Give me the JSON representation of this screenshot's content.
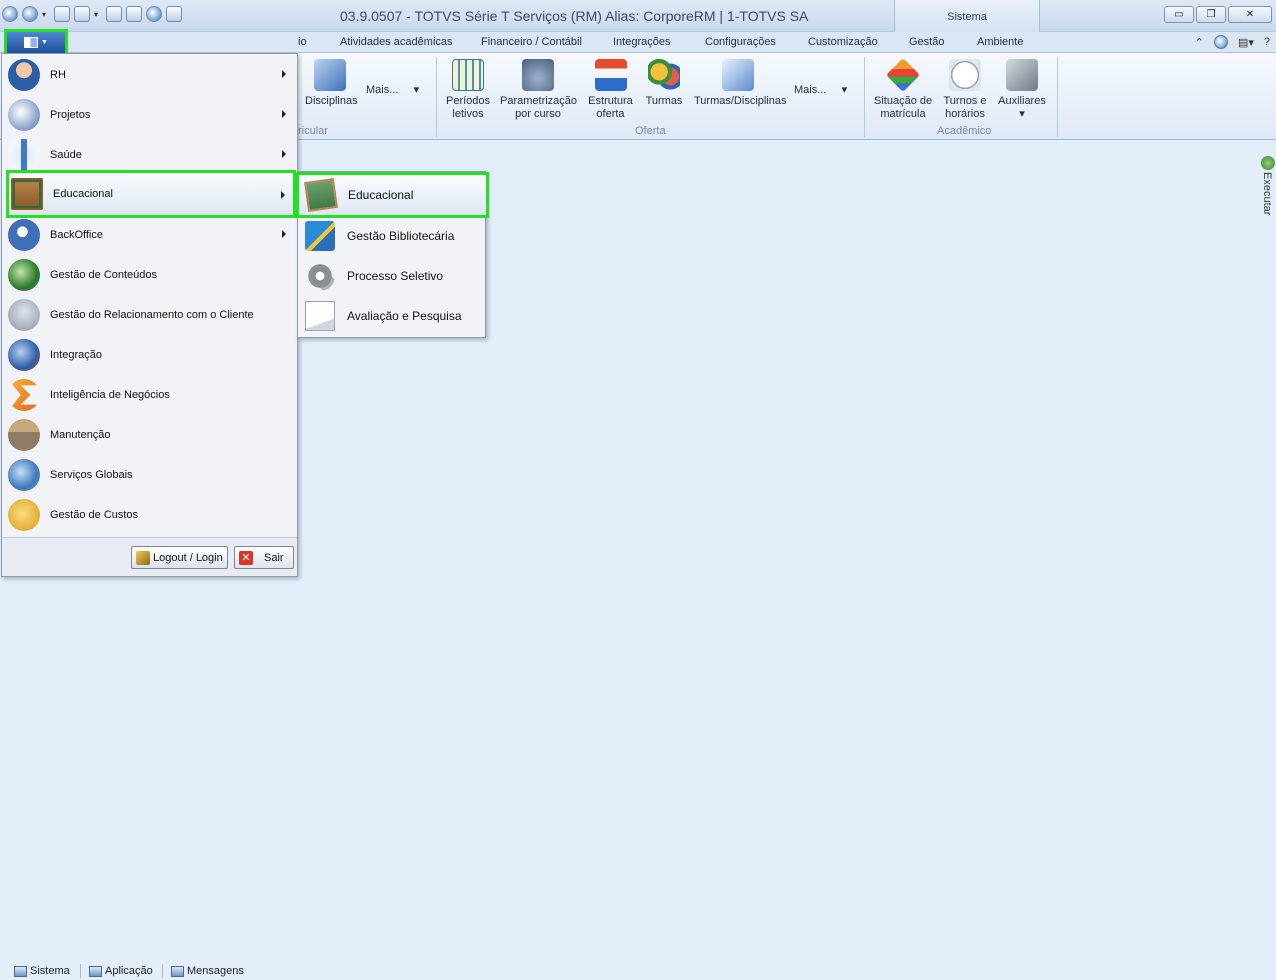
{
  "window": {
    "title": "03.9.0507 - TOTVS Série T Serviços (RM) Alias: CorporeRM | 1-TOTVS SA",
    "context_tab": "Sistema",
    "buttons": {
      "minimize": "▭",
      "restore": "❐",
      "close": "✕"
    }
  },
  "quick_access": [
    "app-icon",
    "refresh-icon",
    "new-window-icon",
    "window-icon",
    "export-icon",
    "tools-icon",
    "globe-icon",
    "copy-icon"
  ],
  "ribbon_tabs": [
    {
      "label": "io"
    },
    {
      "label": "Atividades acadêmicas"
    },
    {
      "label": "Financeiro / Contábil"
    },
    {
      "label": "Integrações"
    },
    {
      "label": "Configurações"
    },
    {
      "label": "Customização"
    },
    {
      "label": "Gestão"
    },
    {
      "label": "Ambiente"
    }
  ],
  "ribbon_groups": {
    "curricular": {
      "label": "ricular",
      "buttons": [
        {
          "label": "Disciplinas",
          "icon": "disciplinas-icon"
        }
      ],
      "more": "Mais..."
    },
    "oferta": {
      "label": "Oferta",
      "buttons": [
        {
          "label": "Períodos\nletivos",
          "l1": "Períodos",
          "l2": "letivos",
          "icon": "calendar-icon"
        },
        {
          "l1": "Parametrização",
          "l2": "por curso",
          "icon": "parameters-icon"
        },
        {
          "l1": "Estrutura",
          "l2": "oferta",
          "icon": "structure-icon"
        },
        {
          "l1": "Turmas",
          "l2": "",
          "icon": "classes-icon"
        },
        {
          "l1": "Turmas/Disciplinas",
          "l2": "",
          "icon": "classes-disciplines-icon"
        }
      ],
      "more": "Mais..."
    },
    "academico": {
      "label": "Acadêmico",
      "buttons": [
        {
          "l1": "Situação de",
          "l2": "matrícula",
          "icon": "enrollment-status-icon"
        },
        {
          "l1": "Turnos e",
          "l2": "horários",
          "icon": "clock-icon"
        },
        {
          "l1": "Auxiliares",
          "l2": "",
          "icon": "auxiliary-icon"
        }
      ]
    }
  },
  "side_tab": "Executar",
  "app_menu": {
    "items": [
      {
        "label": "RH",
        "has_submenu": true
      },
      {
        "label": "Projetos",
        "has_submenu": true
      },
      {
        "label": "Saúde",
        "has_submenu": true
      },
      {
        "label": "Educacional",
        "has_submenu": true,
        "selected": true
      },
      {
        "label": "BackOffice",
        "has_submenu": true
      },
      {
        "label": "Gestão de Conteúdos",
        "has_submenu": false
      },
      {
        "label": "Gestão do Relacionamento com o Cliente",
        "has_submenu": false
      },
      {
        "label": "Integração",
        "has_submenu": false
      },
      {
        "label": "Inteligência de Negócios",
        "has_submenu": false
      },
      {
        "label": "Manutenção",
        "has_submenu": false
      },
      {
        "label": "Serviços Globais",
        "has_submenu": false
      },
      {
        "label": "Gestão de Custos",
        "has_submenu": false
      }
    ],
    "footer": {
      "login_label": "Logout / Login",
      "exit_label": "Sair"
    }
  },
  "submenu": {
    "items": [
      {
        "label": "Educacional",
        "selected": true
      },
      {
        "label": "Gestão Bibliotecária"
      },
      {
        "label": "Processo Seletivo"
      },
      {
        "label": "Avaliação e Pesquisa"
      }
    ]
  },
  "statusbar": [
    {
      "label": "Sistema"
    },
    {
      "label": "Aplicação"
    },
    {
      "label": "Mensagens"
    }
  ],
  "colors": {
    "highlight": "#23e023",
    "background": "#e3eefb"
  }
}
